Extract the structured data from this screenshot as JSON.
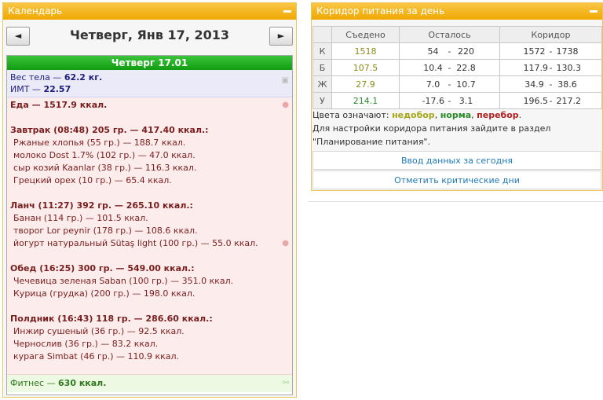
{
  "calendar": {
    "title": "Календарь",
    "prev_label": "◄",
    "next_label": "►",
    "date_title": "Четверг, Янв 17, 2013",
    "day_header": "Четверг 17.01",
    "weight_label": "Вес тела — ",
    "weight_value": "62.2 кг.",
    "bmi_label": "ИМТ — ",
    "bmi_value": "22.57",
    "food_total_label": "Еда — ",
    "food_total_value": "1517.9 ккал.",
    "meals": [
      {
        "header": "Завтрак (08:48) 205 гр. — 417.40 ккал.:",
        "items": [
          "Ржаные хлопья (55 гр.) — 188.7 ккал.",
          "молоко Dost 1.7% (102 гр.) — 47.0 ккал.",
          "сыр козий Kaanlar (38 гр.) — 116.3 ккал.",
          "Грецкий орех (10 гр.) — 65.4 ккал."
        ]
      },
      {
        "header": "Ланч (11:27) 392 гр. — 265.10 ккал.:",
        "items": [
          "Банан (114 гр.) — 101.5 ккал.",
          "творог Lor peynir (178 гр.) — 108.6 ккал.",
          "йогурт натуральный Sütaş light (100 гр.) — 55.0 ккал."
        ]
      },
      {
        "header": "Обед (16:25) 300 гр. — 549.00 ккал.:",
        "items": [
          "Чечевица зеленая Saban (100 гр.) — 351.0 ккал.",
          "Курица (грудка) (200 гр.) — 198.0 ккал."
        ]
      },
      {
        "header": "Полдник (16:43) 118 гр. — 286.60 ккал.:",
        "items": [
          "Инжир сушеный (36 гр.) — 92.5 ккал.",
          "Чернослив (36 гр.) — 83.2 ккал.",
          "курага Simbat (46 гр.) — 110.9 ккал."
        ]
      }
    ],
    "fitness_label": "Фитнес — ",
    "fitness_value": "630 ккал."
  },
  "corridor": {
    "title": "Коридор питания за день",
    "headers": [
      "",
      "Съедено",
      "Осталось",
      "Коридор"
    ],
    "rows": [
      {
        "label": "К",
        "eaten": "1518",
        "left_min": "54",
        "left_max": "220",
        "cor_min": "1572",
        "cor_max": "1738",
        "status": "under"
      },
      {
        "label": "Б",
        "eaten": "107.5",
        "left_min": "10.4",
        "left_max": "22.8",
        "cor_min": "117.9",
        "cor_max": "130.3",
        "status": "under"
      },
      {
        "label": "Ж",
        "eaten": "27.9",
        "left_min": "7.0",
        "left_max": "10.7",
        "cor_min": "34.9",
        "cor_max": "38.6",
        "status": "under"
      },
      {
        "label": "У",
        "eaten": "214.1",
        "left_min": "-17.6",
        "left_max": "3.1",
        "cor_min": "196.5",
        "cor_max": "217.2",
        "status": "normal"
      }
    ],
    "dash": "-",
    "legend_prefix": "Цвета означают: ",
    "legend_under": "недобор",
    "legend_sep1": ", ",
    "legend_norm": "норма",
    "legend_sep2": ", ",
    "legend_over": "перебор",
    "legend_end": ".",
    "info_line1": "Для настройки коридора питания зайдите в раздел",
    "info_line2": "\"Планирование питания\".",
    "btn_input": "Ввод данных за сегодня",
    "btn_critical": "Отметить критические дни"
  },
  "colors": {
    "header_orange": "#f0a800",
    "day_green": "#119c11",
    "under": "#a6a61a",
    "normal": "#2a8a2a",
    "over": "#b02020",
    "link": "#1e7ab8"
  }
}
